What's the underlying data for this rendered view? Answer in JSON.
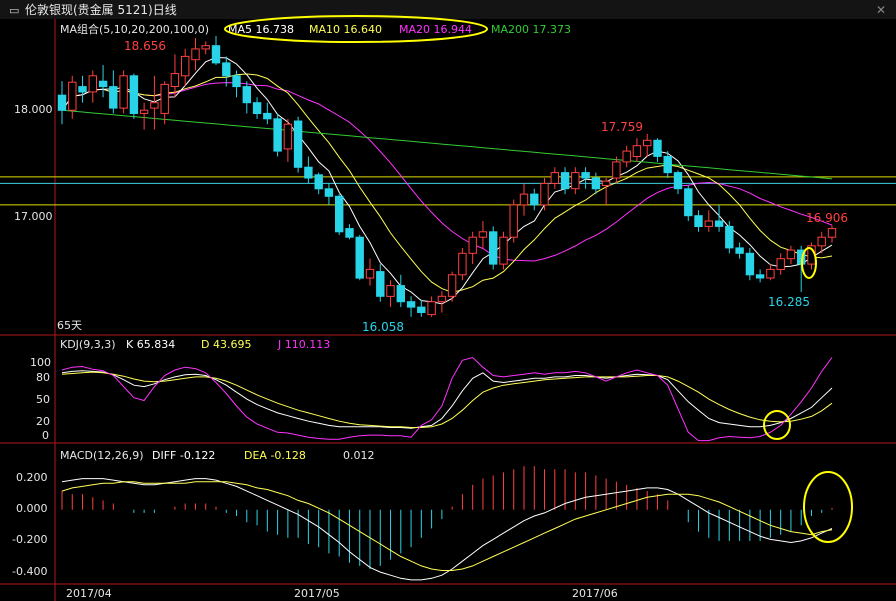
{
  "window": {
    "title": "伦敦银现(贵金属 5121)日线",
    "controls": [
      "▭",
      "✕"
    ]
  },
  "colors": {
    "up": "#ff4040",
    "down": "#29d4e8",
    "ma5": "#ffffff",
    "ma10": "#ffff55",
    "ma20": "#ff33ff",
    "ma200": "#33cc33",
    "axis": "#b01818",
    "hline_yellow": "#e0e000",
    "hline_cyan": "#3fd0e0",
    "annot": "#ffff00",
    "label": "#e6e6e6"
  },
  "chart_data": [
    {
      "type": "candlestick",
      "title": "MA组合(5,10,20,200,100,0)",
      "legend": [
        {
          "name": "MA5",
          "value": "16.738"
        },
        {
          "name": "MA10",
          "value": "16.640"
        },
        {
          "name": "MA20",
          "value": "16.944"
        },
        {
          "name": "MA200",
          "value": "17.373"
        }
      ],
      "y_ticks": [
        "18.000",
        "17.000"
      ],
      "ylim": [
        15.9,
        18.8
      ],
      "x_ticks": [
        "2017/04",
        "2017/05",
        "2017/06"
      ],
      "period_label": "65天",
      "annotations": [
        {
          "text": "18.656",
          "type": "high"
        },
        {
          "text": "17.759",
          "type": "high"
        },
        {
          "text": "16.906",
          "type": "last"
        },
        {
          "text": "16.058",
          "type": "low"
        },
        {
          "text": "16.285",
          "type": "low"
        }
      ],
      "horizontal_lines": [
        17.36,
        17.3,
        17.1
      ],
      "candles": [
        [
          18.12,
          18.25,
          17.85,
          17.98
        ],
        [
          17.98,
          18.3,
          17.9,
          18.24
        ],
        [
          18.2,
          18.3,
          18.05,
          18.15
        ],
        [
          18.15,
          18.35,
          18.05,
          18.3
        ],
        [
          18.25,
          18.4,
          18.1,
          18.2
        ],
        [
          18.2,
          18.35,
          17.95,
          18.0
        ],
        [
          18.0,
          18.35,
          17.95,
          18.3
        ],
        [
          18.3,
          18.32,
          17.9,
          17.95
        ],
        [
          17.95,
          18.05,
          17.8,
          17.98
        ],
        [
          18.0,
          18.3,
          17.8,
          18.05
        ],
        [
          17.95,
          18.25,
          17.85,
          18.22
        ],
        [
          18.2,
          18.5,
          18.1,
          18.32
        ],
        [
          18.3,
          18.55,
          18.2,
          18.48
        ],
        [
          18.45,
          18.65,
          18.35,
          18.55
        ],
        [
          18.55,
          18.62,
          18.5,
          18.58
        ],
        [
          18.58,
          18.67,
          18.4,
          18.42
        ],
        [
          18.42,
          18.48,
          18.2,
          18.3
        ],
        [
          18.3,
          18.35,
          18.1,
          18.2
        ],
        [
          18.2,
          18.25,
          17.95,
          18.05
        ],
        [
          18.05,
          18.1,
          17.9,
          17.95
        ],
        [
          17.95,
          18.05,
          17.85,
          17.9
        ],
        [
          17.9,
          17.95,
          17.55,
          17.6
        ],
        [
          17.62,
          17.9,
          17.5,
          17.85
        ],
        [
          17.88,
          17.92,
          17.4,
          17.45
        ],
        [
          17.45,
          17.55,
          17.3,
          17.35
        ],
        [
          17.38,
          17.4,
          17.2,
          17.25
        ],
        [
          17.25,
          17.3,
          17.1,
          17.18
        ],
        [
          17.18,
          17.2,
          16.82,
          16.85
        ],
        [
          16.88,
          16.92,
          16.78,
          16.8
        ],
        [
          16.8,
          16.82,
          16.4,
          16.42
        ],
        [
          16.42,
          16.6,
          16.35,
          16.5
        ],
        [
          16.48,
          16.55,
          16.2,
          16.25
        ],
        [
          16.25,
          16.4,
          16.15,
          16.35
        ],
        [
          16.35,
          16.45,
          16.15,
          16.2
        ],
        [
          16.2,
          16.25,
          16.06,
          16.15
        ],
        [
          16.15,
          16.22,
          16.06,
          16.1
        ],
        [
          16.08,
          16.25,
          16.06,
          16.2
        ],
        [
          16.2,
          16.3,
          16.1,
          16.25
        ],
        [
          16.25,
          16.48,
          16.2,
          16.45
        ],
        [
          16.45,
          16.7,
          16.4,
          16.65
        ],
        [
          16.65,
          16.85,
          16.55,
          16.8
        ],
        [
          16.8,
          16.95,
          16.7,
          16.85
        ],
        [
          16.85,
          16.9,
          16.5,
          16.55
        ],
        [
          16.55,
          16.85,
          16.5,
          16.8
        ],
        [
          16.8,
          17.15,
          16.75,
          17.1
        ],
        [
          17.1,
          17.3,
          17.0,
          17.2
        ],
        [
          17.2,
          17.25,
          17.05,
          17.1
        ],
        [
          17.1,
          17.35,
          17.05,
          17.3
        ],
        [
          17.3,
          17.45,
          17.25,
          17.4
        ],
        [
          17.4,
          17.45,
          17.2,
          17.25
        ],
        [
          17.25,
          17.45,
          17.2,
          17.4
        ],
        [
          17.4,
          17.45,
          17.25,
          17.35
        ],
        [
          17.35,
          17.4,
          17.2,
          17.25
        ],
        [
          17.28,
          17.35,
          17.1,
          17.32
        ],
        [
          17.35,
          17.55,
          17.3,
          17.5
        ],
        [
          17.5,
          17.65,
          17.45,
          17.6
        ],
        [
          17.55,
          17.72,
          17.5,
          17.65
        ],
        [
          17.65,
          17.76,
          17.55,
          17.7
        ],
        [
          17.7,
          17.72,
          17.5,
          17.55
        ],
        [
          17.55,
          17.6,
          17.35,
          17.4
        ],
        [
          17.4,
          17.42,
          17.2,
          17.25
        ],
        [
          17.25,
          17.28,
          16.95,
          17.0
        ],
        [
          17.0,
          17.05,
          16.85,
          16.9
        ],
        [
          16.9,
          17.05,
          16.85,
          16.95
        ],
        [
          16.95,
          17.1,
          16.85,
          16.9
        ],
        [
          16.9,
          16.95,
          16.65,
          16.7
        ],
        [
          16.7,
          16.75,
          16.6,
          16.65
        ],
        [
          16.65,
          16.7,
          16.4,
          16.45
        ],
        [
          16.45,
          16.5,
          16.38,
          16.42
        ],
        [
          16.42,
          16.55,
          16.4,
          16.5
        ],
        [
          16.5,
          16.65,
          16.45,
          16.6
        ],
        [
          16.6,
          16.72,
          16.55,
          16.68
        ],
        [
          16.68,
          16.72,
          16.29,
          16.55
        ],
        [
          16.55,
          16.75,
          16.5,
          16.72
        ],
        [
          16.72,
          16.85,
          16.65,
          16.8
        ],
        [
          16.8,
          16.91,
          16.75,
          16.88
        ]
      ]
    },
    {
      "type": "line",
      "title": "KDJ(9,3,3)",
      "legend": [
        {
          "name": "K",
          "value": "65.834"
        },
        {
          "name": "D",
          "value": "43.695"
        },
        {
          "name": "J",
          "value": "110.113"
        }
      ],
      "y_ticks": [
        "100",
        "80",
        "50",
        "20",
        "0"
      ],
      "ylim": [
        -12,
        118
      ],
      "series": [
        {
          "name": "K",
          "values": [
            88,
            90,
            91,
            90,
            89,
            85,
            78,
            70,
            68,
            72,
            78,
            82,
            85,
            86,
            84,
            78,
            70,
            60,
            50,
            42,
            36,
            30,
            26,
            22,
            18,
            15,
            12,
            10,
            10,
            10,
            10,
            10,
            9,
            9,
            8,
            10,
            12,
            22,
            40,
            62,
            80,
            88,
            76,
            74,
            76,
            78,
            80,
            80,
            82,
            82,
            84,
            84,
            82,
            80,
            82,
            84,
            86,
            85,
            84,
            78,
            62,
            46,
            34,
            22,
            16,
            14,
            12,
            10,
            10,
            12,
            16,
            22,
            30,
            38,
            52,
            66
          ]
        },
        {
          "name": "D",
          "values": [
            86,
            87,
            88,
            89,
            88,
            86,
            83,
            79,
            76,
            75,
            76,
            78,
            80,
            82,
            82,
            80,
            76,
            70,
            63,
            56,
            50,
            44,
            39,
            34,
            30,
            26,
            22,
            18,
            15,
            13,
            12,
            11,
            10,
            10,
            9,
            9,
            10,
            14,
            22,
            34,
            48,
            60,
            66,
            70,
            72,
            74,
            76,
            78,
            79,
            80,
            81,
            82,
            82,
            82,
            82,
            82,
            83,
            84,
            84,
            82,
            76,
            68,
            60,
            50,
            42,
            35,
            29,
            24,
            20,
            18,
            17,
            18,
            21,
            25,
            33,
            44
          ]
        },
        {
          "name": "J",
          "values": [
            92,
            96,
            97,
            93,
            91,
            84,
            68,
            52,
            48,
            68,
            84,
            92,
            96,
            94,
            88,
            74,
            58,
            40,
            24,
            14,
            8,
            2,
            1,
            -2,
            -5,
            -7,
            -8,
            -8,
            -5,
            -3,
            -2,
            -2,
            -3,
            -3,
            -5,
            12,
            20,
            40,
            80,
            106,
            110,
            96,
            84,
            82,
            84,
            86,
            88,
            86,
            88,
            88,
            90,
            88,
            82,
            76,
            82,
            88,
            92,
            88,
            84,
            70,
            36,
            2,
            -10,
            -10,
            -6,
            -4,
            -5,
            -6,
            -4,
            2,
            12,
            28,
            46,
            66,
            90,
            110
          ]
        }
      ]
    },
    {
      "type": "bar+line",
      "title": "MACD(12,26,9)",
      "legend": [
        {
          "name": "DIFF",
          "value": "-0.122"
        },
        {
          "name": "DEA",
          "value": "-0.128"
        },
        {
          "name": "",
          "value": "0.012"
        }
      ],
      "y_ticks": [
        "0.200",
        "0.000",
        "-0.200",
        "-0.400"
      ],
      "ylim": [
        -0.47,
        0.3
      ],
      "series": [
        {
          "name": "DIFF",
          "values": [
            0.18,
            0.19,
            0.2,
            0.2,
            0.2,
            0.19,
            0.18,
            0.17,
            0.16,
            0.16,
            0.17,
            0.18,
            0.19,
            0.2,
            0.2,
            0.19,
            0.17,
            0.15,
            0.12,
            0.09,
            0.06,
            0.03,
            0.0,
            -0.03,
            -0.07,
            -0.11,
            -0.16,
            -0.21,
            -0.27,
            -0.32,
            -0.37,
            -0.4,
            -0.42,
            -0.44,
            -0.45,
            -0.45,
            -0.44,
            -0.42,
            -0.38,
            -0.33,
            -0.28,
            -0.23,
            -0.19,
            -0.15,
            -0.11,
            -0.07,
            -0.04,
            -0.02,
            0.01,
            0.04,
            0.06,
            0.08,
            0.09,
            0.1,
            0.11,
            0.12,
            0.13,
            0.14,
            0.14,
            0.13,
            0.1,
            0.06,
            0.02,
            -0.02,
            -0.05,
            -0.08,
            -0.11,
            -0.14,
            -0.17,
            -0.19,
            -0.2,
            -0.21,
            -0.2,
            -0.18,
            -0.15,
            -0.12
          ]
        },
        {
          "name": "DEA",
          "values": [
            0.12,
            0.14,
            0.15,
            0.16,
            0.17,
            0.17,
            0.18,
            0.18,
            0.17,
            0.17,
            0.17,
            0.17,
            0.17,
            0.18,
            0.18,
            0.18,
            0.18,
            0.17,
            0.16,
            0.14,
            0.13,
            0.11,
            0.09,
            0.06,
            0.04,
            0.01,
            -0.02,
            -0.06,
            -0.1,
            -0.14,
            -0.18,
            -0.22,
            -0.26,
            -0.3,
            -0.33,
            -0.36,
            -0.38,
            -0.39,
            -0.39,
            -0.38,
            -0.36,
            -0.33,
            -0.3,
            -0.27,
            -0.24,
            -0.21,
            -0.18,
            -0.15,
            -0.12,
            -0.09,
            -0.06,
            -0.04,
            -0.02,
            0.0,
            0.02,
            0.04,
            0.06,
            0.08,
            0.09,
            0.1,
            0.1,
            0.1,
            0.09,
            0.07,
            0.05,
            0.02,
            -0.01,
            -0.04,
            -0.07,
            -0.1,
            -0.12,
            -0.14,
            -0.15,
            -0.16,
            -0.14,
            -0.128
          ]
        },
        {
          "name": "MACD",
          "values": [
            0.12,
            0.1,
            0.1,
            0.08,
            0.06,
            0.04,
            0.0,
            -0.02,
            -0.02,
            -0.02,
            0.0,
            0.02,
            0.04,
            0.04,
            0.04,
            0.02,
            -0.02,
            -0.04,
            -0.08,
            -0.1,
            -0.14,
            -0.16,
            -0.18,
            -0.18,
            -0.22,
            -0.24,
            -0.28,
            -0.3,
            -0.34,
            -0.36,
            -0.38,
            -0.36,
            -0.32,
            -0.28,
            -0.24,
            -0.18,
            -0.12,
            -0.06,
            0.02,
            0.1,
            0.16,
            0.2,
            0.22,
            0.24,
            0.26,
            0.28,
            0.28,
            0.26,
            0.26,
            0.26,
            0.24,
            0.24,
            0.22,
            0.2,
            0.18,
            0.16,
            0.14,
            0.12,
            0.1,
            0.06,
            0.0,
            -0.08,
            -0.14,
            -0.18,
            -0.2,
            -0.2,
            -0.2,
            -0.2,
            -0.2,
            -0.18,
            -0.16,
            -0.14,
            -0.1,
            -0.04,
            -0.02,
            0.012
          ]
        }
      ]
    }
  ]
}
